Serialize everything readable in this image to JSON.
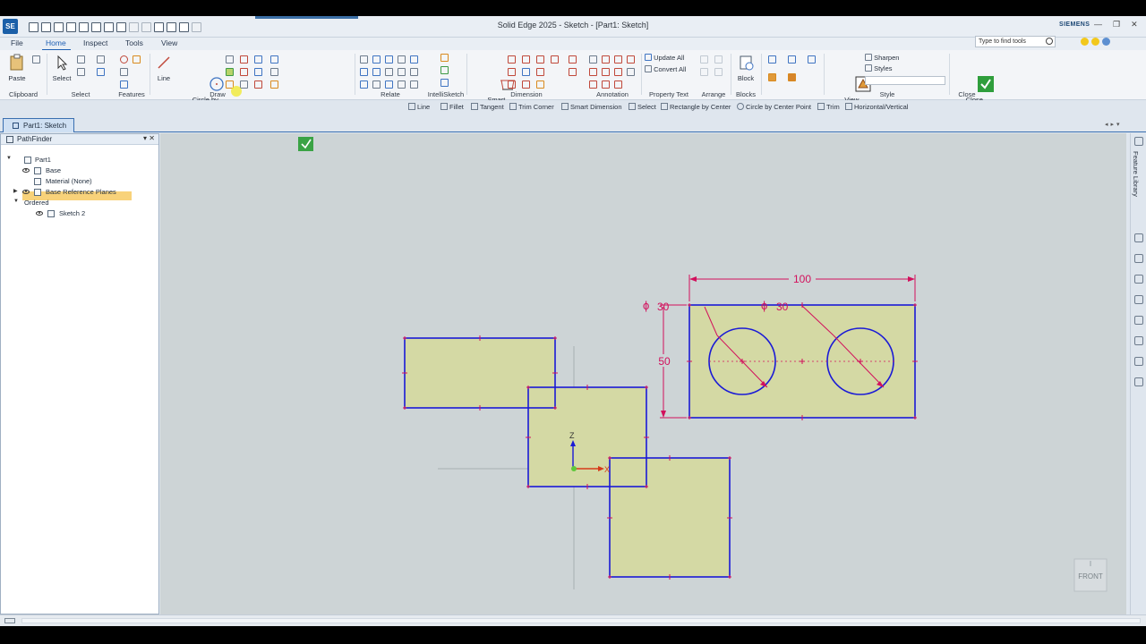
{
  "window": {
    "title": "Solid Edge 2025 - Sketch - [Part1: Sketch]",
    "brand": "SIEMENS",
    "controls": [
      "—",
      "❐",
      "✕"
    ]
  },
  "menu": {
    "file": "File",
    "tabs": [
      "Home",
      "Inspect",
      "Tools",
      "View"
    ],
    "active_tab": "Home",
    "search_placeholder": "Type to find tools"
  },
  "ribbon": {
    "clipboard": {
      "paste": "Paste",
      "group": "Clipboard"
    },
    "select": {
      "select": "Select",
      "group": "Select"
    },
    "features": {
      "group": "Features"
    },
    "draw": {
      "line": "Line",
      "circle": "Circle by\nCenter Point",
      "group": "Draw"
    },
    "relate": {
      "group": "Relate"
    },
    "intellisketch": {
      "group": "IntelliSketch"
    },
    "dimension": {
      "smart": "Smart\nDimension",
      "group": "Dimension"
    },
    "annotation": {
      "group": "Annotation"
    },
    "property_text": {
      "update_all": "Update All",
      "convert_all": "Convert All",
      "group": "Property Text"
    },
    "arrange": {
      "group": "Arrange"
    },
    "blocks": {
      "block": "Block",
      "group": "Blocks"
    },
    "style": {
      "view_overrides": "View\nOverrides",
      "sharpen": "Sharpen",
      "styles": "Styles",
      "group": "Style"
    },
    "close": {
      "close_sketch": "Close\nSketch",
      "group": "Close"
    }
  },
  "command_bar": [
    "Line",
    "Fillet",
    "Tangent",
    "Trim Corner",
    "Smart Dimension",
    "Select",
    "Rectangle by Center",
    "Circle by Center Point",
    "Trim",
    "Horizontal/Vertical"
  ],
  "document_tab": "Part1: Sketch",
  "pathfinder": {
    "title": "PathFinder",
    "items": [
      {
        "label": "Part1"
      },
      {
        "label": "Base"
      },
      {
        "label": "Material (None)"
      },
      {
        "label": "Base Reference Planes"
      },
      {
        "label": "Ordered"
      },
      {
        "label": "Sketch 2"
      }
    ]
  },
  "right_panel": {
    "label": "Feature Library"
  },
  "viewport": {
    "dimension_width": "100",
    "dimension_height": "50",
    "diameter_left": "30",
    "diameter_right": "30",
    "diameter_symbol": "ϕ",
    "axis_z": "Z",
    "axis_x": "X",
    "view_cube": "FRONT",
    "accent_sketch": "#1a1ad6",
    "accent_dimension": "#d2105c",
    "region_fill": "#d4d9a4"
  }
}
